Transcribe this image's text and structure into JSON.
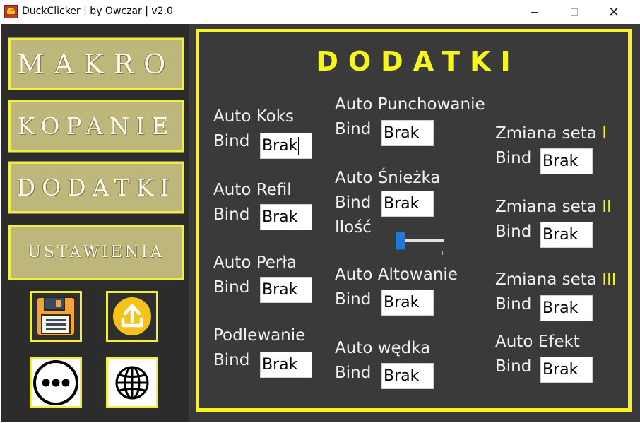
{
  "window": {
    "title": "DuckClicker | by Owczar | v2.0",
    "close_glyph": "✕"
  },
  "sidebar": {
    "nav": {
      "makro": "MAKRO",
      "kopanie": "KOPANIE",
      "dodatki": "DODATKI",
      "ustawienia": "USTAWIENIA"
    },
    "icons": [
      "save-icon",
      "upload-icon",
      "more-icon",
      "globe-icon"
    ]
  },
  "main": {
    "title": "DODATKI",
    "bind_label": "Bind",
    "col1": [
      {
        "label": "Auto Koks",
        "bind": "Brak"
      },
      {
        "label": "Auto Refil",
        "bind": "Brak"
      },
      {
        "label": "Auto Perła",
        "bind": "Brak"
      },
      {
        "label": "Podlewanie",
        "bind": "Brak"
      }
    ],
    "col2": [
      {
        "label": "Auto Punchowanie",
        "bind": "Brak"
      },
      {
        "label": "Auto Śnieżka",
        "bind": "Brak",
        "amount_label": "Ilość"
      },
      {
        "label": "Auto Altowanie",
        "bind": "Brak"
      },
      {
        "label": "Auto wędka",
        "bind": "Brak"
      }
    ],
    "col3": [
      {
        "label": "Zmiana seta",
        "numeral": "I",
        "bind": "Brak"
      },
      {
        "label": "Zmiana seta",
        "numeral": "II",
        "bind": "Brak"
      },
      {
        "label": "Zmiana seta",
        "numeral": "III",
        "bind": "Brak"
      },
      {
        "label": "Auto Efekt",
        "bind": "Brak"
      }
    ],
    "snowball_amount": {
      "min": 0,
      "max": 10,
      "value": 0
    }
  },
  "colors": {
    "accent_yellow": "#f7f51c",
    "nav_button": "#bdb77b",
    "panel_bg": "#3a3a3a",
    "sidebar_bg": "#2c2c2c",
    "slider_blue": "#1e7ad8"
  }
}
